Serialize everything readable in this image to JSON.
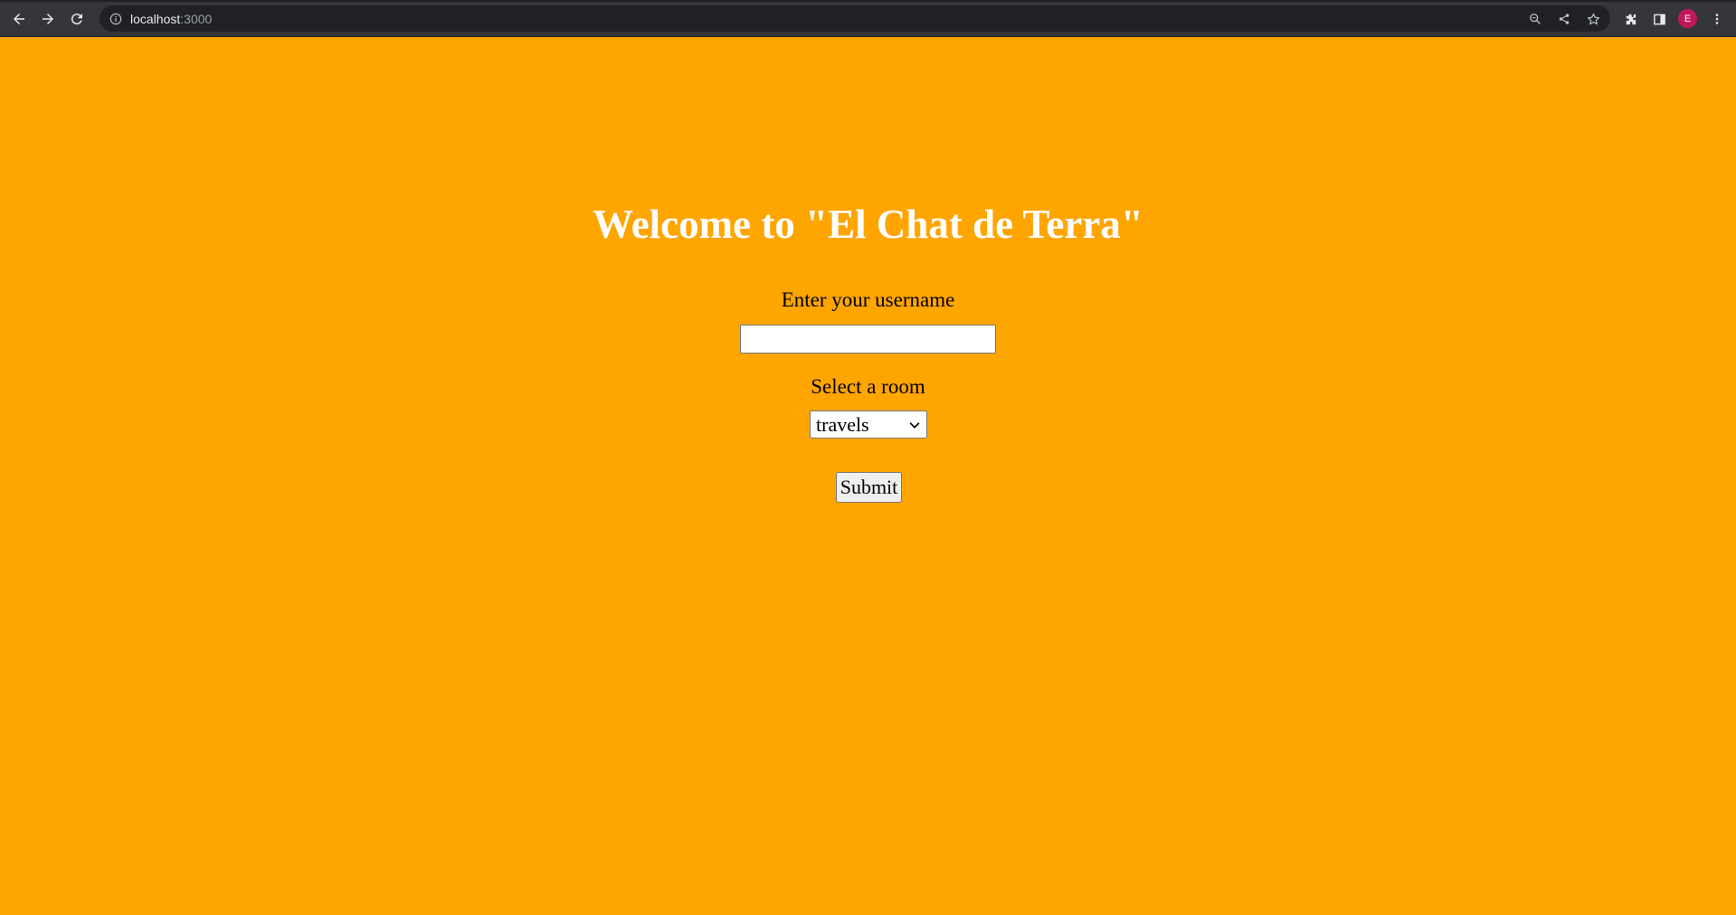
{
  "browser": {
    "url_host": "localhost",
    "url_port": ":3000",
    "profile_initial": "E"
  },
  "page": {
    "title": "Welcome to \"El Chat de Terra\"",
    "username_label": "Enter your username",
    "username_value": "",
    "room_label": "Select a room",
    "room_selected": "travels",
    "submit_label": "Submit"
  },
  "colors": {
    "background": "#FFA500",
    "title": "#ffffff",
    "browser_bar": "#35363a",
    "avatar": "#c2185b"
  },
  "icons": [
    "back-arrow-icon",
    "forward-arrow-icon",
    "reload-icon",
    "info-icon",
    "zoom-icon",
    "share-icon",
    "bookmark-star-icon",
    "extensions-icon",
    "side-panel-icon",
    "menu-dots-icon",
    "chevron-down-icon"
  ]
}
